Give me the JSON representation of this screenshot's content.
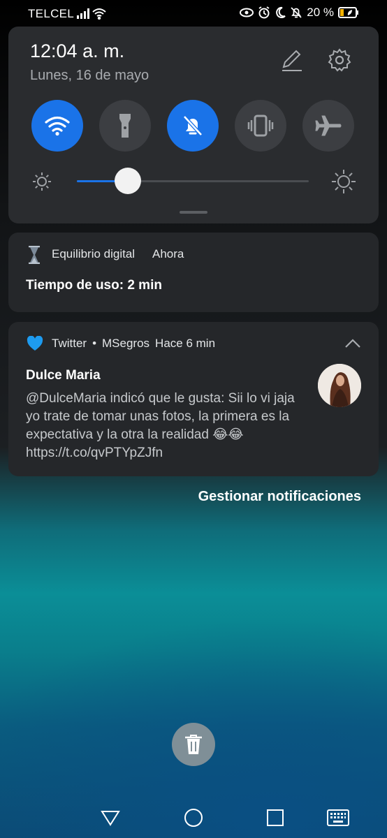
{
  "status_bar": {
    "carrier": "TELCEL",
    "battery_percent": "20 %",
    "icons": [
      "signal-icon",
      "wifi-icon",
      "eye-icon",
      "alarm-icon",
      "moon-icon",
      "bell-off-icon",
      "battery-saver-icon"
    ]
  },
  "quick_settings": {
    "time": "12:04 a. m.",
    "date": "Lunes, 16 de mayo",
    "tiles": [
      {
        "name": "wifi",
        "icon": "wifi-icon",
        "active": true
      },
      {
        "name": "flashlight",
        "icon": "flashlight-icon",
        "active": false
      },
      {
        "name": "silent",
        "icon": "bell-off-icon",
        "active": true
      },
      {
        "name": "vibrate",
        "icon": "vibrate-icon",
        "active": false
      },
      {
        "name": "airplane",
        "icon": "airplane-icon",
        "active": false
      }
    ],
    "brightness_level": 0.22
  },
  "notifications": {
    "digital_balance": {
      "app": "Equilibrio digital",
      "time": "Ahora",
      "title": "Tiempo de uso: 2 min"
    },
    "twitter": {
      "app": "Twitter",
      "separator": "•",
      "account": "MSegros",
      "time": "Hace 6 min",
      "sender": "Dulce Maria",
      "message": "@DulceMaria indicó que le gusta: Sii lo vi jaja yo trate de tomar unas fotos, la primera es la expectativa y la otra la realidad 😂😂 https://t.co/qvPTYpZJfn"
    }
  },
  "manage_label": "Gestionar notificaciones",
  "colors": {
    "accent": "#1a73e8",
    "twitter_heart": "#1d9bf0"
  }
}
